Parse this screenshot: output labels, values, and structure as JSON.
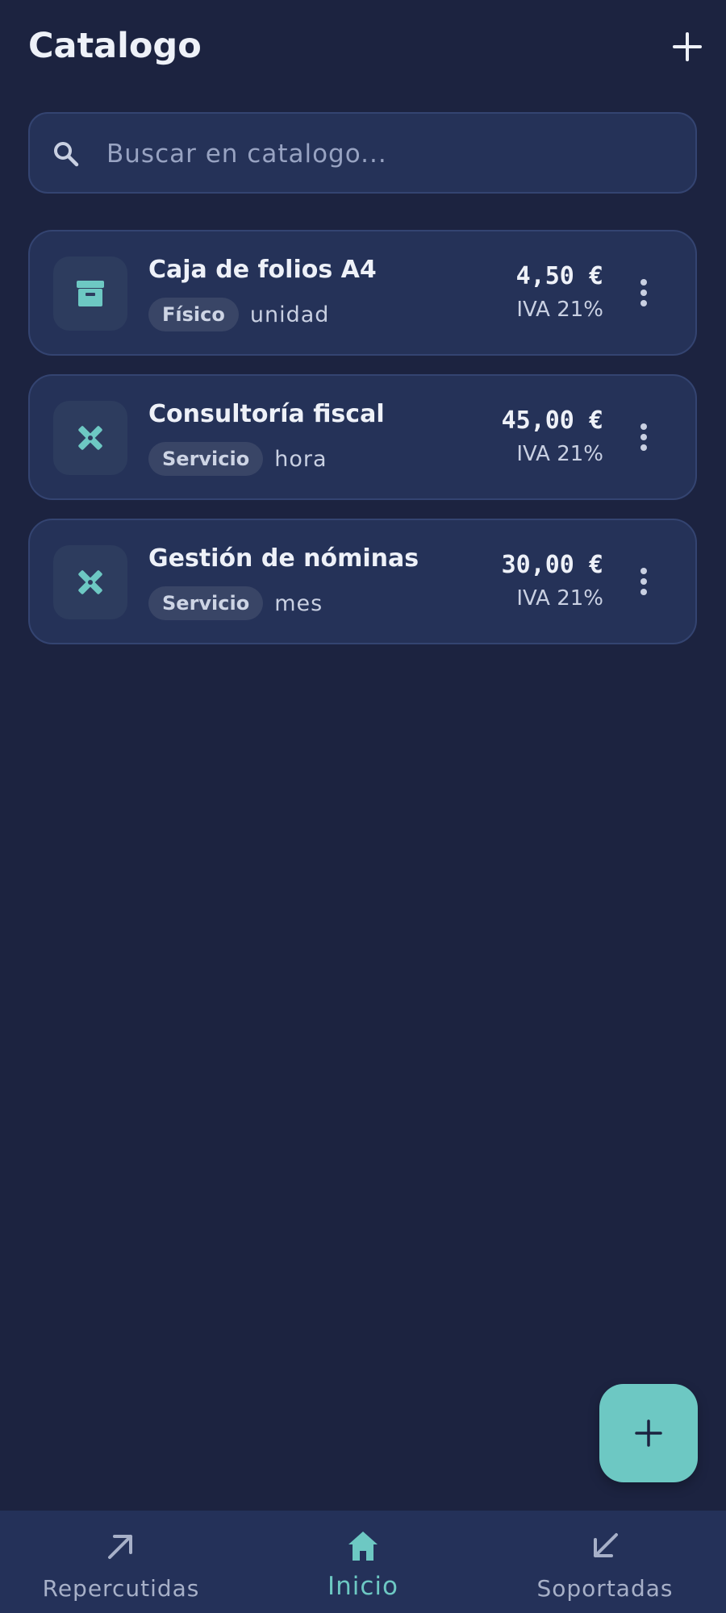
{
  "header": {
    "title": "Catalogo"
  },
  "search": {
    "placeholder": "Buscar en catalogo..."
  },
  "items": [
    {
      "name": "Caja de folios A4",
      "type": "Físico",
      "unit": "unidad",
      "price": "4,50 €",
      "tax": "IVA 21%",
      "icon": "archive-icon"
    },
    {
      "name": "Consultoría fiscal",
      "type": "Servicio",
      "unit": "hora",
      "price": "45,00 €",
      "tax": "IVA 21%",
      "icon": "tools-icon"
    },
    {
      "name": "Gestión de nóminas",
      "type": "Servicio",
      "unit": "mes",
      "price": "30,00 €",
      "tax": "IVA 21%",
      "icon": "tools-icon"
    }
  ],
  "nav": {
    "items": [
      {
        "label": "Repercutidas",
        "icon": "arrow-up-right-icon"
      },
      {
        "label": "Inicio",
        "icon": "home-icon",
        "active": true
      },
      {
        "label": "Soportadas",
        "icon": "arrow-down-left-icon"
      }
    ]
  },
  "colors": {
    "background": "#1c2340",
    "card": "#253258",
    "accent": "#6dc8c3"
  }
}
